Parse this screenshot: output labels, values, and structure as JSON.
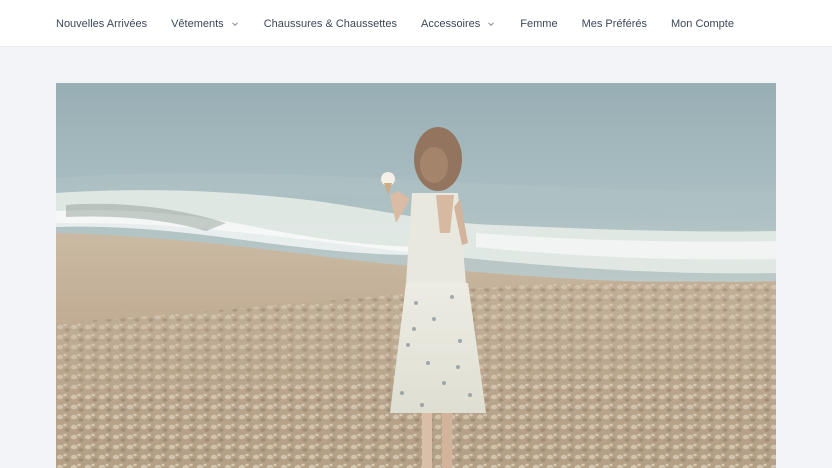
{
  "nav": {
    "items": [
      {
        "label": "Nouvelles Arrivées",
        "has_dropdown": false
      },
      {
        "label": "Vêtements",
        "has_dropdown": true
      },
      {
        "label": "Chaussures & Chaussettes",
        "has_dropdown": false
      },
      {
        "label": "Accessoires",
        "has_dropdown": true
      },
      {
        "label": "Femme",
        "has_dropdown": false
      },
      {
        "label": "Mes Préférés",
        "has_dropdown": false
      },
      {
        "label": "Mon Compte",
        "has_dropdown": false
      }
    ]
  },
  "hero": {
    "icon": "beach-photo"
  },
  "colors": {
    "page_bg": "#f2f4f7",
    "header_bg": "#ffffff",
    "nav_text": "#3c4858"
  }
}
